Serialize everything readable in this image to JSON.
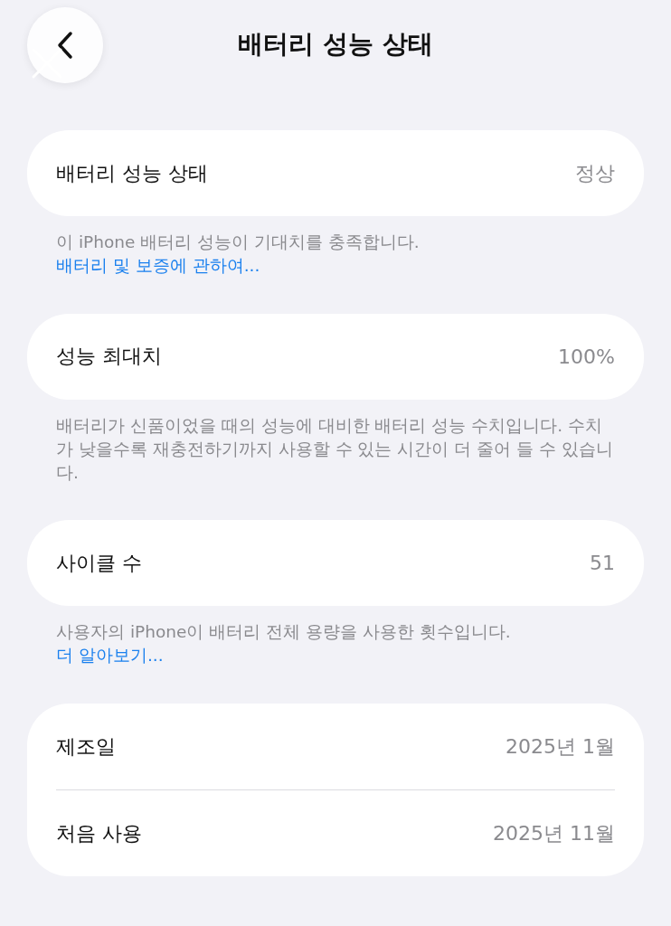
{
  "nav": {
    "title": "배터리 성능 상태"
  },
  "sections": [
    {
      "rows": [
        {
          "label": "배터리 성능 상태",
          "value": "정상"
        }
      ],
      "footer": {
        "text": "이 iPhone 배터리 성능이 기대치를 충족합니다. ",
        "link": "배터리 및 보증에 관하여..."
      }
    },
    {
      "rows": [
        {
          "label": "성능 최대치",
          "value": "100%"
        }
      ],
      "footer": {
        "text": "배터리가 신품이었을 때의 성능에 대비한 배터리 성능 수치입니다. 수치가 낮을수록 재충전하기까지 사용할 수 있는 시간이 더 줄어 들 수 있습니다."
      }
    },
    {
      "rows": [
        {
          "label": "사이클 수",
          "value": "51"
        }
      ],
      "footer": {
        "text": "사용자의 iPhone이 배터리 전체 용량을 사용한 횟수입니다. ",
        "link": "더 알아보기..."
      }
    },
    {
      "rows": [
        {
          "label": "제조일",
          "value": "2025년 1월"
        },
        {
          "label": "처음 사용",
          "value": "2025년 11월"
        }
      ]
    }
  ]
}
